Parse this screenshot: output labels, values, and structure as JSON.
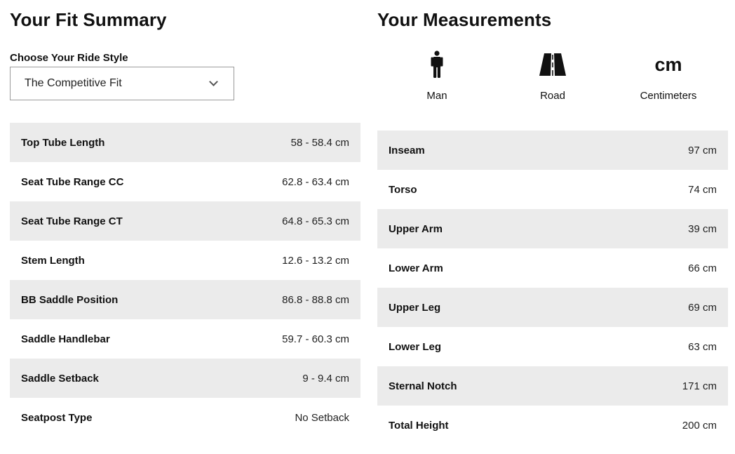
{
  "fit_summary": {
    "title": "Your Fit Summary",
    "ride_style_label": "Choose Your Ride Style",
    "ride_style_value": "The Competitive Fit",
    "rows": [
      {
        "label": "Top Tube Length",
        "value": "58 - 58.4 cm"
      },
      {
        "label": "Seat Tube Range CC",
        "value": "62.8 - 63.4 cm"
      },
      {
        "label": "Seat Tube Range CT",
        "value": "64.8 - 65.3 cm"
      },
      {
        "label": "Stem Length",
        "value": "12.6 - 13.2 cm"
      },
      {
        "label": "BB Saddle Position",
        "value": "86.8 - 88.8 cm"
      },
      {
        "label": "Saddle Handlebar",
        "value": "59.7 - 60.3 cm"
      },
      {
        "label": "Saddle Setback",
        "value": "9 - 9.4 cm"
      },
      {
        "label": "Seatpost Type",
        "value": "No Setback"
      }
    ]
  },
  "measurements": {
    "title": "Your Measurements",
    "units": [
      {
        "icon": "man-icon",
        "label": "Man"
      },
      {
        "icon": "road-icon",
        "label": "Road"
      },
      {
        "icon": "cm",
        "label": "Centimeters"
      }
    ],
    "rows": [
      {
        "label": "Inseam",
        "value": "97 cm"
      },
      {
        "label": "Torso",
        "value": "74 cm"
      },
      {
        "label": "Upper Arm",
        "value": "39 cm"
      },
      {
        "label": "Lower Arm",
        "value": "66 cm"
      },
      {
        "label": "Upper Leg",
        "value": "69 cm"
      },
      {
        "label": "Lower Leg",
        "value": "63 cm"
      },
      {
        "label": "Sternal Notch",
        "value": "171 cm"
      },
      {
        "label": "Total Height",
        "value": "200 cm"
      }
    ]
  },
  "colors": {
    "row_shade": "#ebebeb",
    "text": "#111111",
    "border": "#9a9a9a"
  }
}
